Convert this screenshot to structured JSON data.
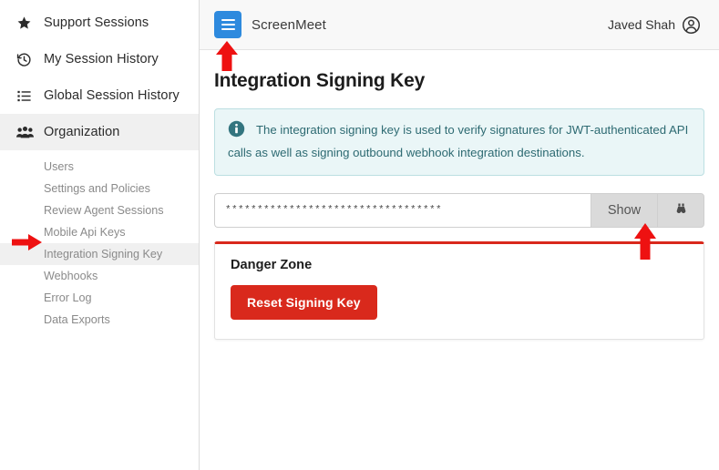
{
  "sidebar": {
    "main_items": [
      {
        "label": "Support Sessions",
        "icon": "star-icon",
        "active": false
      },
      {
        "label": "My Session History",
        "icon": "history-icon",
        "active": false
      },
      {
        "label": "Global Session History",
        "icon": "list-icon",
        "active": false
      },
      {
        "label": "Organization",
        "icon": "people-icon",
        "active": true
      }
    ],
    "sub_items": [
      {
        "label": "Users",
        "active": false
      },
      {
        "label": "Settings and Policies",
        "active": false
      },
      {
        "label": "Review Agent Sessions",
        "active": false
      },
      {
        "label": "Mobile Api Keys",
        "active": false
      },
      {
        "label": "Integration Signing Key",
        "active": true
      },
      {
        "label": "Webhooks",
        "active": false
      },
      {
        "label": "Error Log",
        "active": false
      },
      {
        "label": "Data Exports",
        "active": false
      }
    ]
  },
  "topbar": {
    "menu_icon": "hamburger-icon",
    "brand": "ScreenMeet",
    "user_name": "Javed Shah",
    "avatar_icon": "user-circle-icon"
  },
  "main": {
    "page_title": "Integration Signing Key",
    "alert": {
      "icon": "info-icon",
      "text": "The integration signing key is used to verify signatures for JWT-authenticated API calls as well as signing outbound webhook integration destinations."
    },
    "key_field": {
      "value": "**********************************",
      "placeholder": "",
      "show_label": "Show",
      "reveal_icon": "binoculars-icon"
    },
    "danger_zone": {
      "title": "Danger Zone",
      "reset_label": "Reset Signing Key"
    }
  },
  "annotations": [
    {
      "name": "arrow-to-hamburger",
      "direction": "up"
    },
    {
      "name": "arrow-to-integration-signing-key",
      "direction": "right"
    },
    {
      "name": "arrow-to-show-button",
      "direction": "up"
    }
  ],
  "colors": {
    "brand_blue": "#2e8ade",
    "danger_red": "#d9291c",
    "info_teal": "#2d6a72",
    "info_bg": "#eaf6f7",
    "annotation_red": "#ee1111"
  }
}
